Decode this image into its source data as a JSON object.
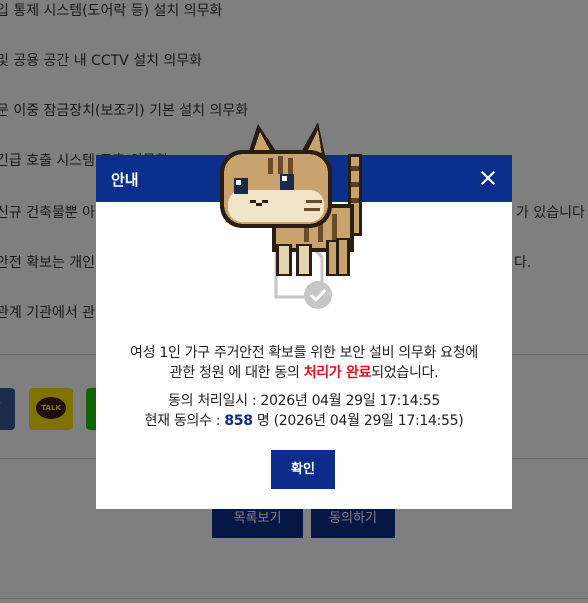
{
  "background": {
    "lines": [
      "입 통제 시스템(도어락 등) 설치 의무화",
      "및 공용 공간 내 CCTV 설치 의무화",
      "문 이중 잠금장치(보조키) 기본 설치 의무화",
      "긴급 호출 시스템 구축 의무화",
      "신규 건축물뿐 아",
      "안전 확보는 개인",
      "관계 기관에서 관"
    ],
    "line_tail_1": "가 있습니다",
    "line_tail_2": "다.",
    "share_fb_label": "f",
    "share_kakao_label": "TALK",
    "list_button": "목록보기",
    "agree_button": "동의하기"
  },
  "modal": {
    "title": "안내",
    "message_part1": "여성 1인 가구 주거안전 확보를 위한 보안 설비 의무화 요청에",
    "message_part2": "관한 청원 에 대한 동의 ",
    "message_highlight": "처리가 완료",
    "message_part3": "되었습니다.",
    "processed_label": "동의 처리일시 : ",
    "processed_datetime": "2026년 04월 29일 17:14:55",
    "count_label": "현재 동의수 : ",
    "count_value": "858",
    "count_suffix": " 명 (2026년 04월 29일 17:14:55)",
    "confirm_button": "확인",
    "colors": {
      "header": "#0a2f8c",
      "highlight": "#e8121f",
      "count": "#0c2d8a"
    },
    "icon": "document-check-icon",
    "mascot": "pixel-cat-mascot"
  }
}
